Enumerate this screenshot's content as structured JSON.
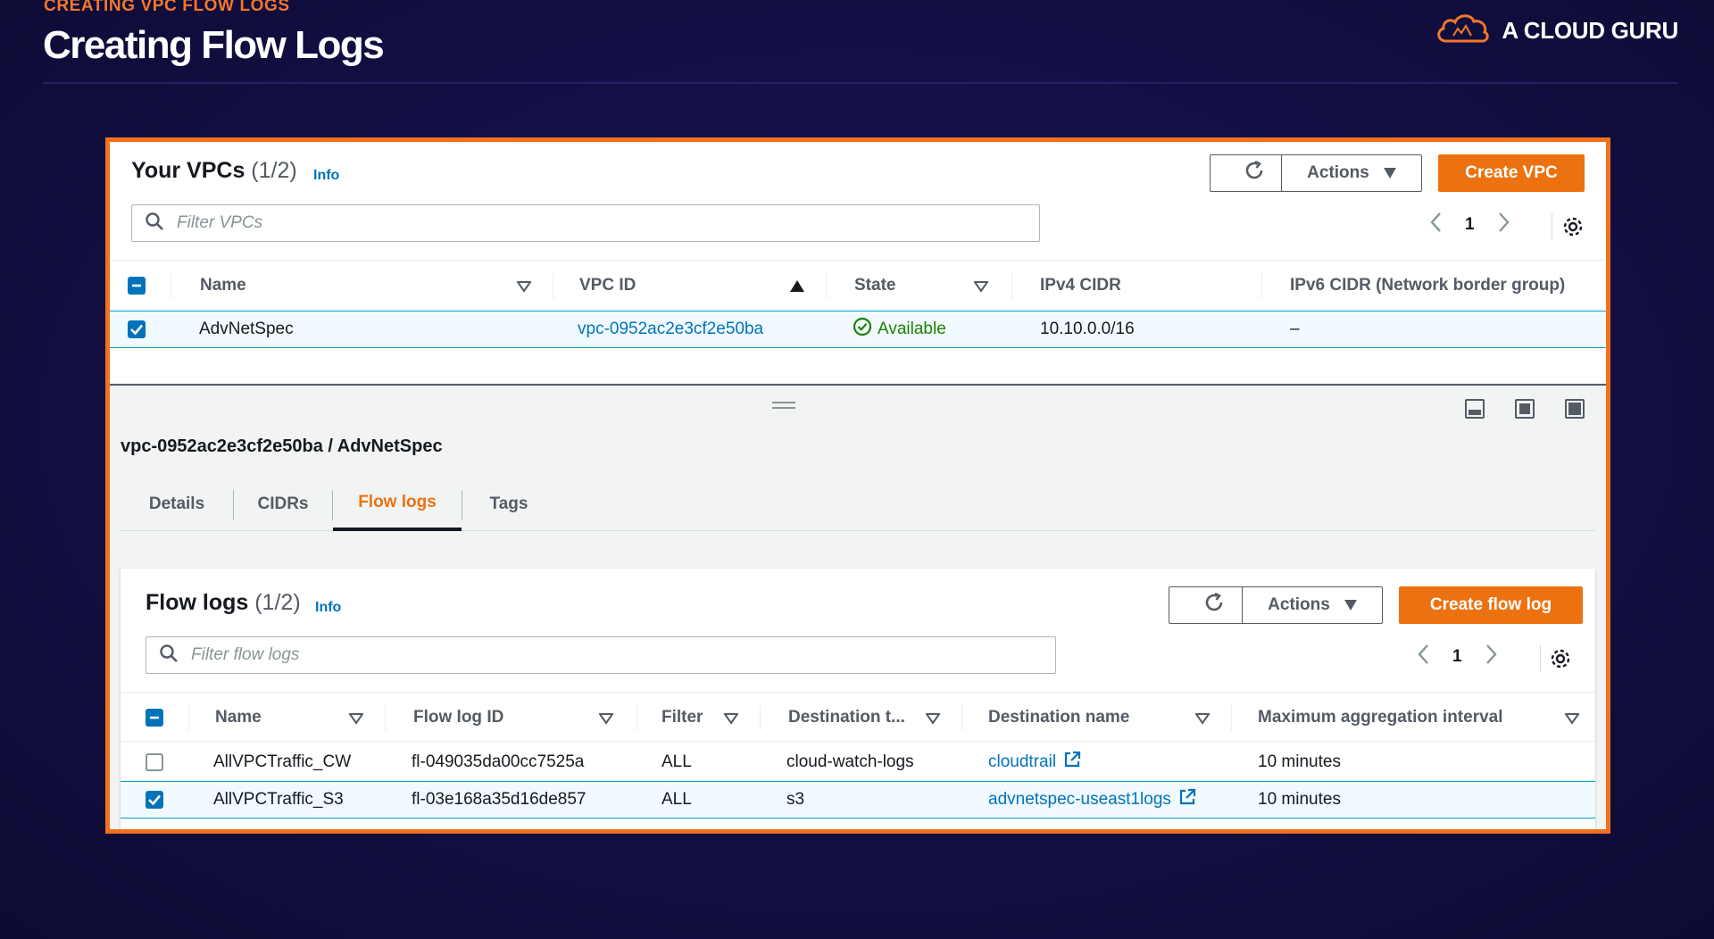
{
  "slide": {
    "eyebrow": "CREATING VPC FLOW LOGS",
    "title": "Creating Flow Logs",
    "logo_text": "A CLOUD GURU"
  },
  "colors": {
    "accent": "#ec7211",
    "link": "#0073bb",
    "success": "#1d8102",
    "frame": "#f2711c"
  },
  "vpcs": {
    "title": "Your VPCs",
    "count": "(1/2)",
    "info": "Info",
    "actions_label": "Actions",
    "create_label": "Create VPC",
    "filter_placeholder": "Filter VPCs",
    "page": "1",
    "columns": [
      "Name",
      "VPC ID",
      "State",
      "IPv4 CIDR",
      "IPv6 CIDR (Network border group)"
    ],
    "rows": [
      {
        "name": "AdvNetSpec",
        "vpc_id": "vpc-0952ac2e3cf2e50ba",
        "state": "Available",
        "ipv4": "10.10.0.0/16",
        "ipv6": "–",
        "selected": true
      }
    ]
  },
  "details": {
    "title": "vpc-0952ac2e3cf2e50ba / AdvNetSpec",
    "tabs": [
      "Details",
      "CIDRs",
      "Flow logs",
      "Tags"
    ],
    "active_tab": "Flow logs"
  },
  "flow_logs": {
    "title": "Flow logs",
    "count": "(1/2)",
    "info": "Info",
    "actions_label": "Actions",
    "create_label": "Create flow log",
    "filter_placeholder": "Filter flow logs",
    "page": "1",
    "columns": [
      "Name",
      "Flow log ID",
      "Filter",
      "Destination t...",
      "Destination name",
      "Maximum aggregation interval"
    ],
    "rows": [
      {
        "name": "AllVPCTraffic_CW",
        "id": "fl-049035da00cc7525a",
        "filter": "ALL",
        "dest_type": "cloud-watch-logs",
        "dest_name": "cloudtrail",
        "interval": "10 minutes",
        "selected": false
      },
      {
        "name": "AllVPCTraffic_S3",
        "id": "fl-03e168a35d16de857",
        "filter": "ALL",
        "dest_type": "s3",
        "dest_name": "advnetspec-useast1logs",
        "interval": "10 minutes",
        "selected": true
      }
    ]
  }
}
